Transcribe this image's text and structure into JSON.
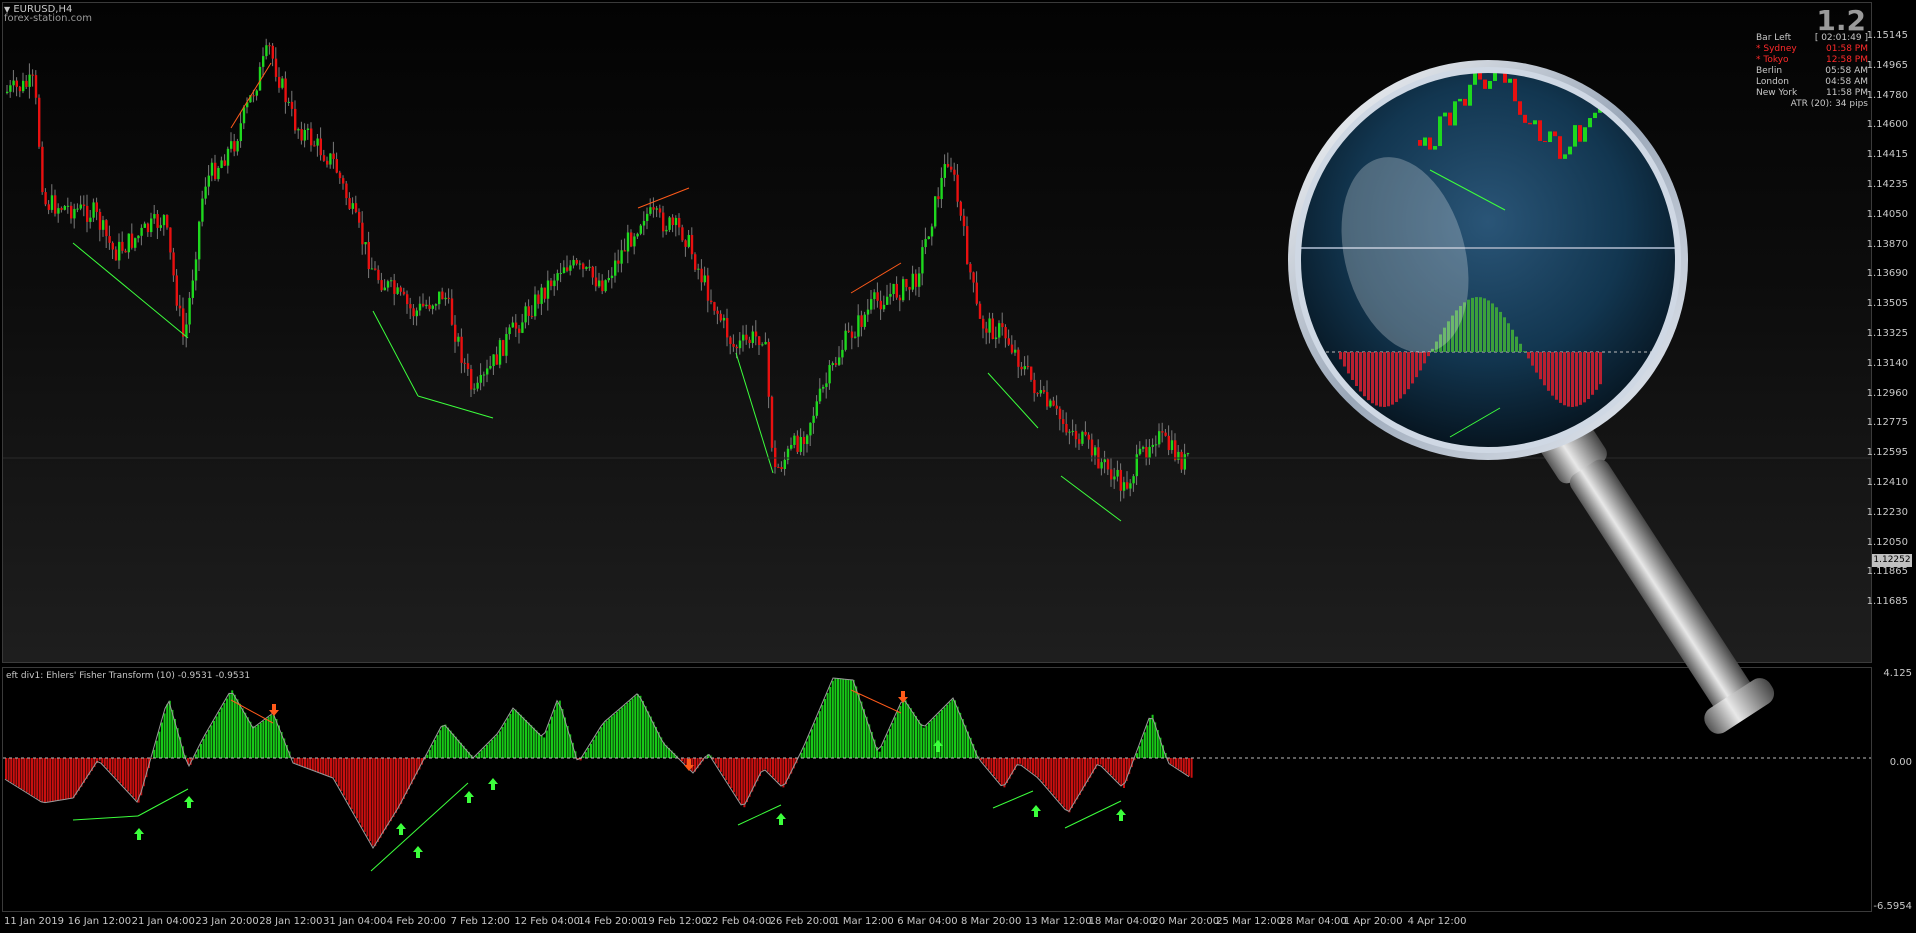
{
  "window": {
    "symbol_title": "EURUSD,H4",
    "watermark": "forex-station.com",
    "big_number": "1.2"
  },
  "info_panel": {
    "rows": [
      {
        "label": "Bar Left",
        "value": "[ 02:01:49 ]",
        "highlight": false
      },
      {
        "label": "* Sydney",
        "value": "01:58 PM",
        "highlight": true
      },
      {
        "label": "* Tokyo",
        "value": "12:58 PM",
        "highlight": true
      },
      {
        "label": "Berlin",
        "value": "05:58 AM",
        "highlight": false
      },
      {
        "label": "London",
        "value": "04:58 AM",
        "highlight": false
      },
      {
        "label": "New York",
        "value": "11:58 PM",
        "highlight": false
      }
    ],
    "atr": "ATR (20): 34 pips"
  },
  "price_axis": {
    "labels": [
      "1.15145",
      "1.14965",
      "1.14780",
      "1.14600",
      "1.14415",
      "1.14235",
      "1.14050",
      "1.13870",
      "1.13690",
      "1.13505",
      "1.13325",
      "1.13140",
      "1.12960",
      "1.12775",
      "1.12595",
      "1.12410",
      "1.12230",
      "1.12050",
      "1.11865",
      "1.11685"
    ],
    "current_price": "1.12252"
  },
  "indicator": {
    "title": "eft div1: Ehlers' Fisher Transform (10) -0.9531 -0.9531",
    "max_label": "4.125",
    "zero_label": "0.00",
    "min_label": "-6.5954"
  },
  "time_axis": {
    "labels": [
      "11 Jan 2019",
      "16 Jan 12:00",
      "21 Jan 04:00",
      "23 Jan 20:00",
      "28 Jan 12:00",
      "31 Jan 04:00",
      "4 Feb 20:00",
      "7 Feb 12:00",
      "12 Feb 04:00",
      "14 Feb 20:00",
      "19 Feb 12:00",
      "22 Feb 04:00",
      "26 Feb 20:00",
      "1 Mar 12:00",
      "6 Mar 04:00",
      "8 Mar 20:00",
      "13 Mar 12:00",
      "18 Mar 04:00",
      "20 Mar 20:00",
      "25 Mar 12:00",
      "28 Mar 04:00",
      "1 Apr 20:00",
      "4 Apr 12:00"
    ]
  },
  "colors": {
    "bull": "#1ed81e",
    "bear": "#e81010",
    "hist_bull": "#18c818",
    "hist_bear": "#c81010",
    "div_bull": "#3cff3c",
    "div_bear": "#ff5a1a"
  }
}
